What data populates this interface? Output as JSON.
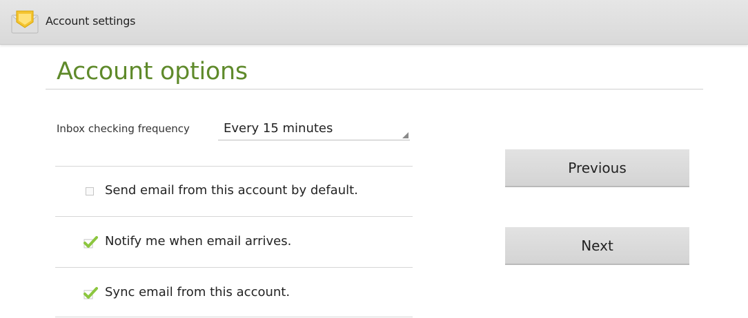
{
  "action_bar": {
    "title": "Account settings",
    "icon": "email-envelope-icon"
  },
  "heading": "Account options",
  "inbox_frequency": {
    "label": "Inbox checking frequency",
    "selected": "Every 15 minutes"
  },
  "options": [
    {
      "label": "Send email from this account by default.",
      "checked": false
    },
    {
      "label": "Notify me when email arrives.",
      "checked": true
    },
    {
      "label": "Sync email from this account.",
      "checked": true
    }
  ],
  "buttons": {
    "previous": "Previous",
    "next": "Next"
  },
  "colors": {
    "accent_green": "#5f8a2b",
    "check_green": "#8cc63f",
    "action_bar_bg": "#e0e0e0",
    "button_bg": "#dadada"
  }
}
